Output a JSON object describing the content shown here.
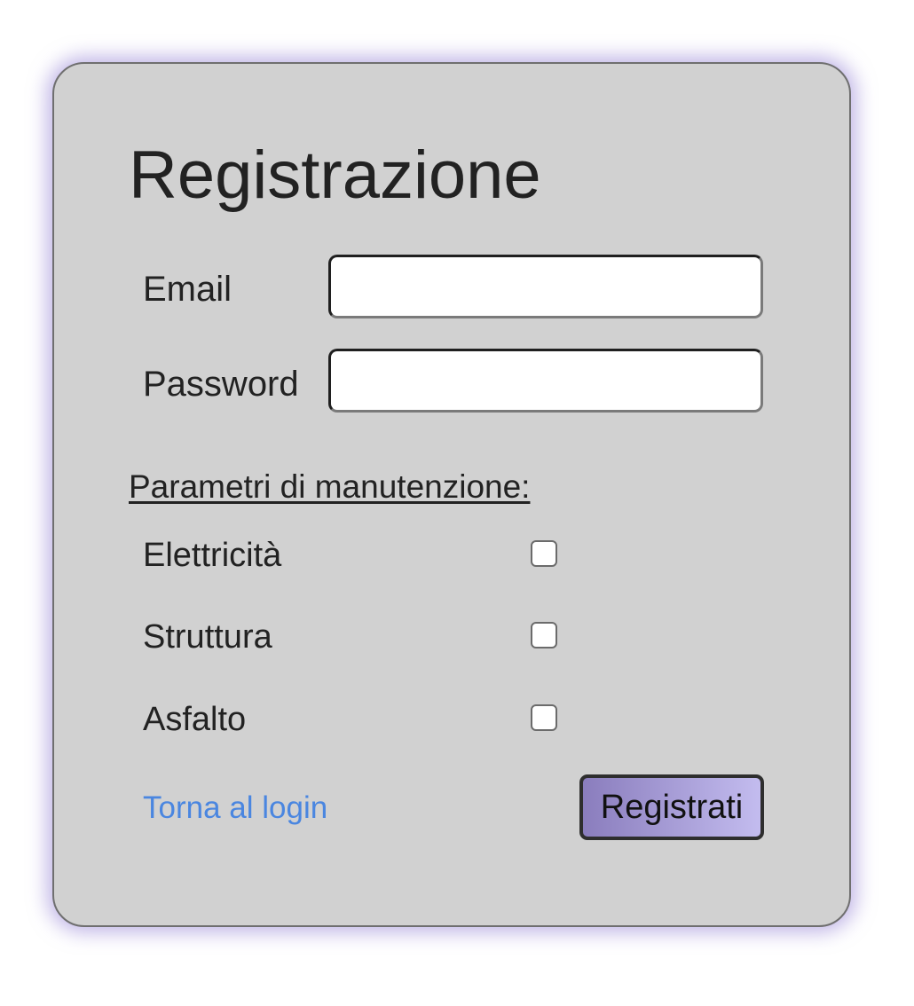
{
  "form": {
    "title": "Registrazione",
    "email_label": "Email",
    "email_value": "",
    "password_label": "Password",
    "password_value": "",
    "section_title": "Parametri di manutenzione:",
    "options": [
      {
        "label": "Elettricità",
        "checked": false
      },
      {
        "label": "Struttura",
        "checked": false
      },
      {
        "label": "Asfalto",
        "checked": false
      }
    ],
    "back_link": "Torna al login",
    "submit_label": "Registrati"
  },
  "colors": {
    "card_background": "#d1d1d1",
    "card_glow": "#8c78d2",
    "link": "#4a86e0",
    "button_gradient_start": "#8a7dbd",
    "button_gradient_end": "#c3bcef"
  }
}
